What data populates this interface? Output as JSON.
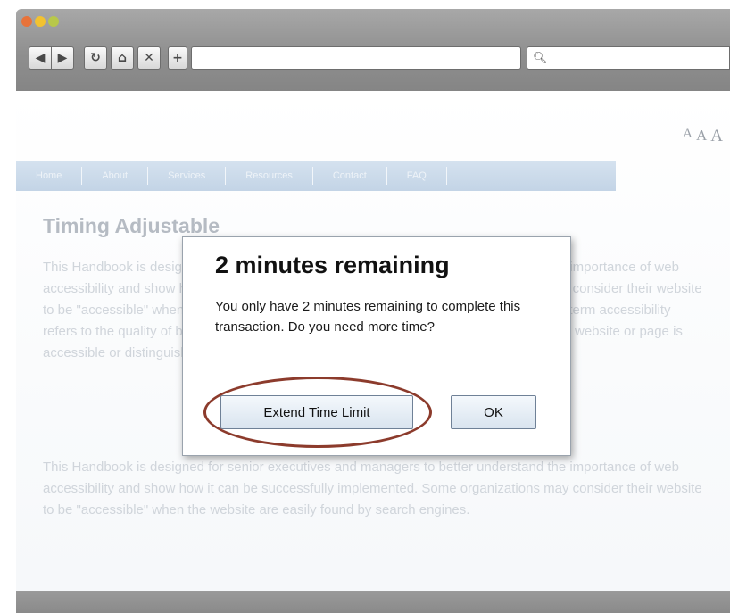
{
  "browser": {
    "nav": {
      "back_icon": "◀",
      "forward_icon": "▶",
      "reload_icon": "↻",
      "home_icon": "⌂",
      "stop_icon": "✕",
      "add_icon": "+"
    },
    "search_icon": "🔍︎"
  },
  "page": {
    "text_size": [
      "A",
      "A",
      "A"
    ],
    "nav_items": [
      "Home",
      "About",
      "Services",
      "Resources",
      "Contact",
      "FAQ"
    ],
    "heading": "Timing Adjustable",
    "paragraph_1": "This Handbook is designed for senior executives and managers to better understand the importance of web accessibility and show how it can be successfully implemented. Some organizations may consider their website to be \"accessible\" when the website ranks easily found by search engines. However, the term accessibility refers to the quality of being easily used or \"handled\" and it refers to the extent to which a website or page is accessible or distinguishable by all people.",
    "paragraph_2": "This Handbook is designed for senior executives and managers to better understand the importance of web accessibility and show how it can be successfully implemented. Some organizations may consider their website to be \"accessible\" when the website are easily found by search engines."
  },
  "dialog": {
    "title": "2 minutes remaining",
    "message": "You only have 2 minutes remaining to complete this transaction. Do you need more time?",
    "extend_label": "Extend Time Limit",
    "ok_label": "OK"
  },
  "colors": {
    "highlight_ring": "#8c3b2c",
    "nav_bar": "#c9d8e8"
  }
}
